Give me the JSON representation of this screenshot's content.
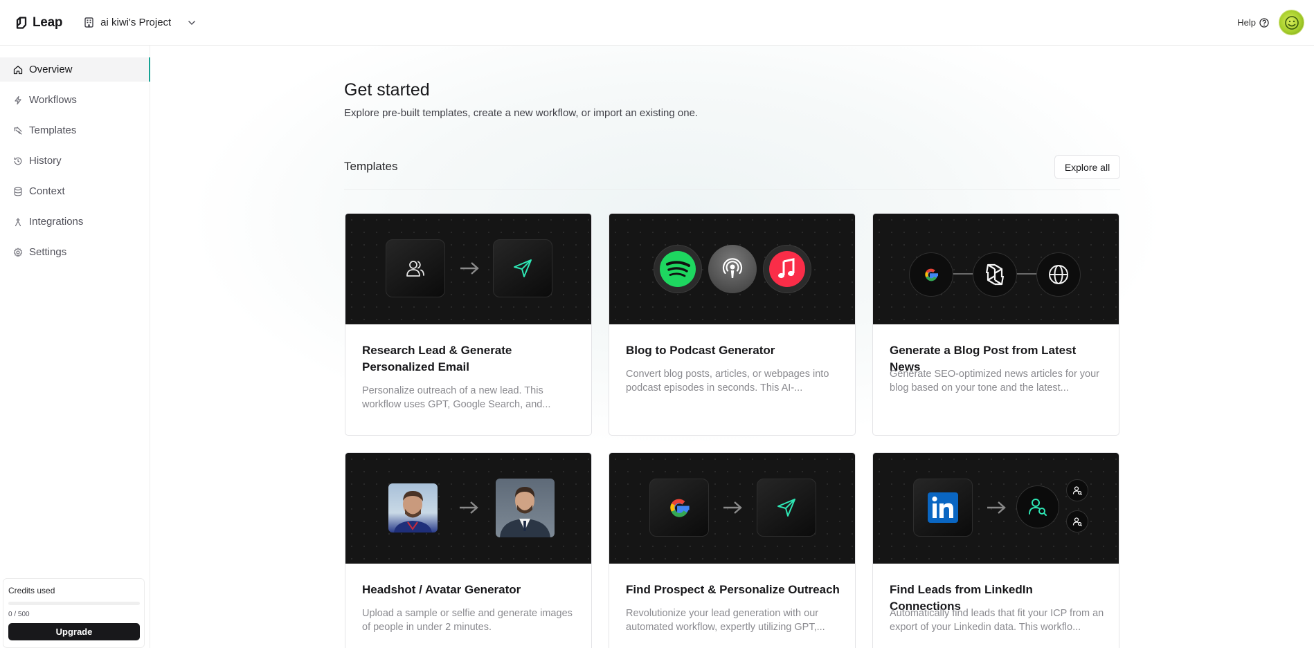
{
  "app": {
    "logo_text": "Leap",
    "project_name": "ai kiwi's Project",
    "help_label": "Help"
  },
  "sidebar": {
    "items": [
      {
        "label": "Overview",
        "icon": "home-icon",
        "active": true
      },
      {
        "label": "Workflows",
        "icon": "bolt-icon",
        "active": false
      },
      {
        "label": "Templates",
        "icon": "templates-icon",
        "active": false
      },
      {
        "label": "History",
        "icon": "history-icon",
        "active": false
      },
      {
        "label": "Context",
        "icon": "database-icon",
        "active": false
      },
      {
        "label": "Integrations",
        "icon": "integrations-icon",
        "active": false
      },
      {
        "label": "Settings",
        "icon": "gear-icon",
        "active": false
      }
    ],
    "credits": {
      "label": "Credits used",
      "count_text": "0 / 500",
      "used_fraction": 0,
      "upgrade_label": "Upgrade"
    }
  },
  "main": {
    "title": "Get started",
    "subtitle": "Explore pre-built templates, create a new workflow, or import an existing one.",
    "section_title": "Templates",
    "explore_label": "Explore all",
    "cards": [
      {
        "title": "Research Lead & Generate Personalized Email",
        "description": "Personalize outreach of a new lead. This workflow uses GPT, Google Search, and..."
      },
      {
        "title": "Blog to Podcast Generator",
        "description": "Convert blog posts, articles, or webpages into podcast episodes in seconds. This AI-..."
      },
      {
        "title": "Generate a Blog Post from Latest News",
        "description": "Generate SEO-optimized news articles for your blog based on your tone and the latest..."
      },
      {
        "title": "Headshot / Avatar Generator",
        "description": "Upload a sample or selfie and generate images of people in under 2 minutes."
      },
      {
        "title": "Find Prospect & Personalize Outreach",
        "description": "Revolutionize your lead generation with our automated workflow, expertly utilizing GPT,..."
      },
      {
        "title": "Find Leads from LinkedIn Connections",
        "description": "Automatically find leads that fit your ICP from an export of your Linkedin data. This workflo..."
      }
    ]
  },
  "colors": {
    "accent": "#16a394",
    "thumb_bg": "#151515",
    "spotify": "#1ed760",
    "apple_music": "#fa2d48",
    "linkedin": "#0a66c2"
  }
}
